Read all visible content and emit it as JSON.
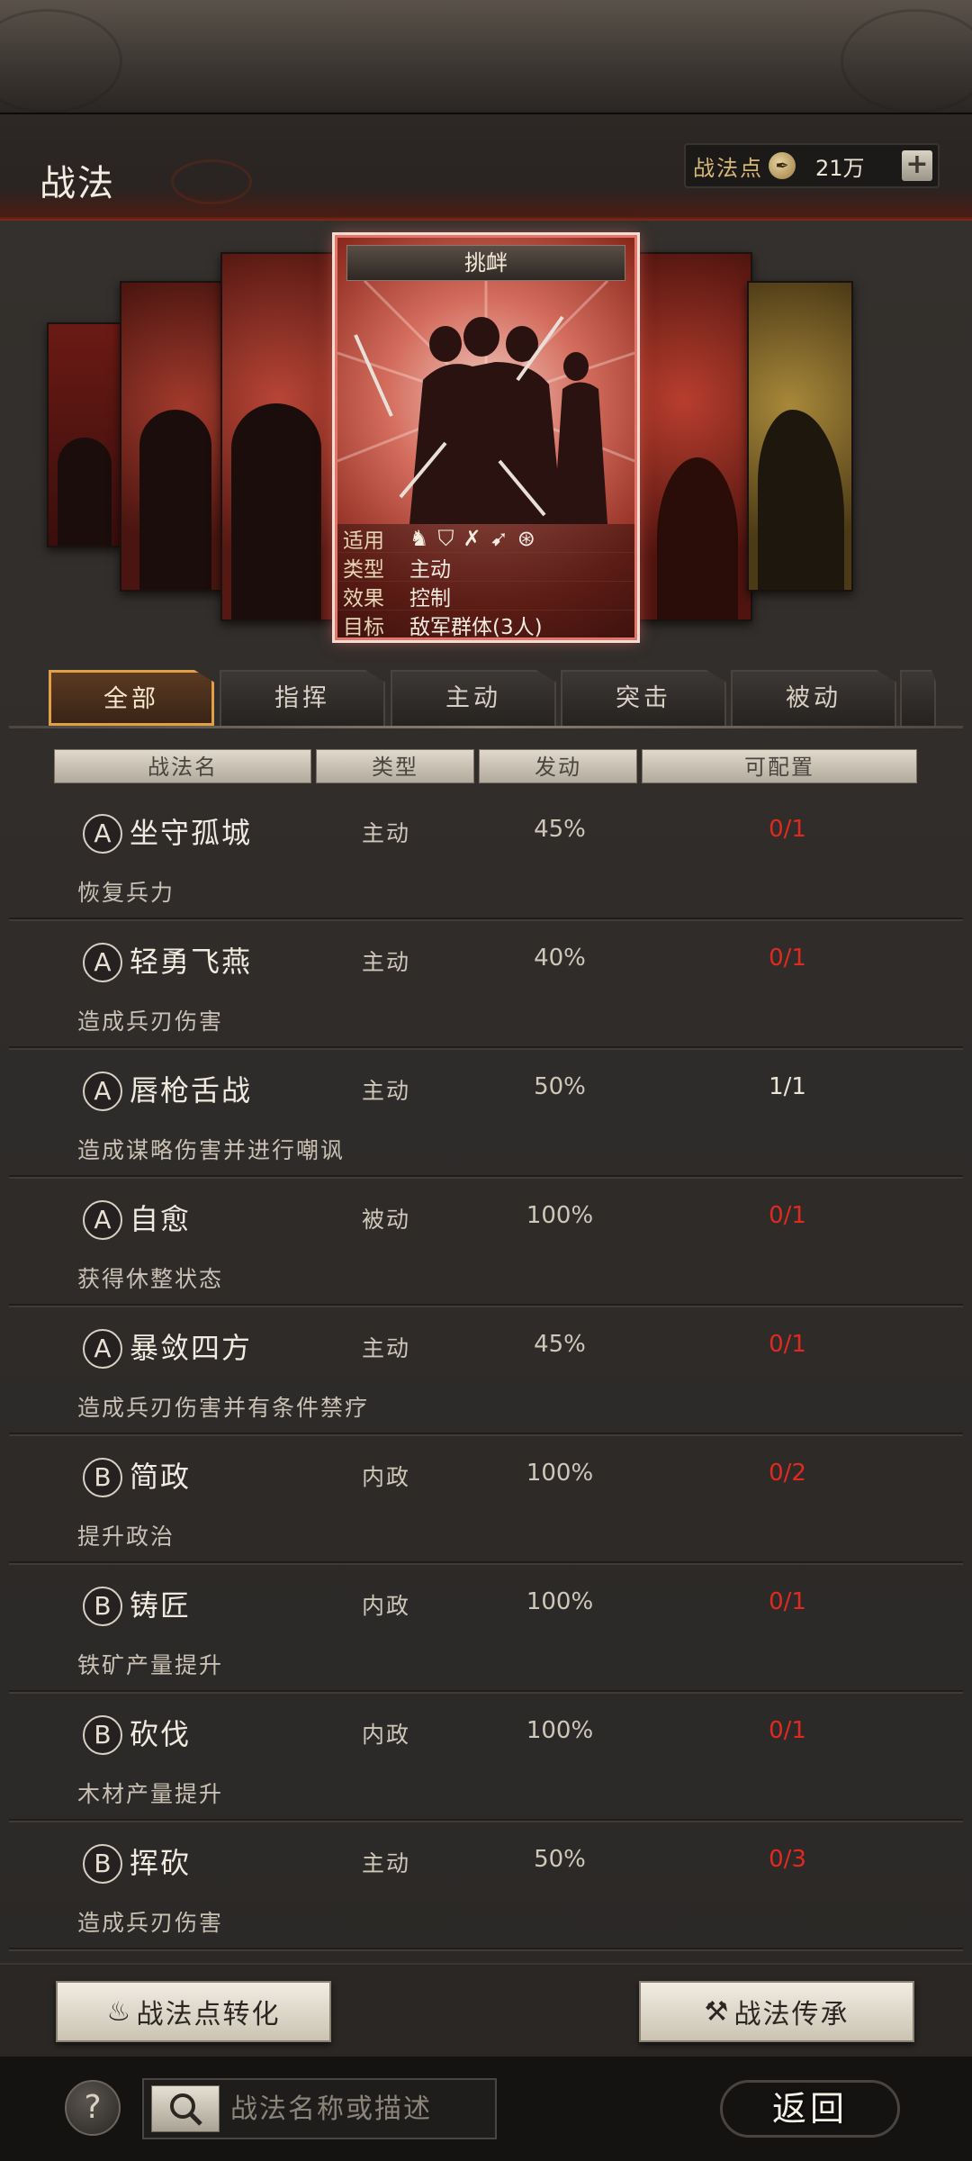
{
  "header": {
    "title": "战法",
    "points_label": "战法点",
    "points_value": "21万",
    "points_add": "+"
  },
  "featured_card": {
    "title": "挑衅",
    "rows": [
      {
        "key": "适用",
        "value": ""
      },
      {
        "key": "类型",
        "value": "主动"
      },
      {
        "key": "效果",
        "value": "控制"
      },
      {
        "key": "目标",
        "value": "敌军群体(3人)"
      }
    ],
    "terrain_icons": [
      "cavalry-icon",
      "shield-icon",
      "bow-icon",
      "spear-icon",
      "wheel-icon"
    ]
  },
  "tabs": [
    "全部",
    "指挥",
    "主动",
    "突击",
    "被动"
  ],
  "columns": [
    "战法名",
    "类型",
    "发动",
    "可配置"
  ],
  "skills": [
    {
      "grade": "A",
      "name": "坐守孤城",
      "type": "主动",
      "rate": "45%",
      "config": "0/1",
      "desc": "恢复兵力"
    },
    {
      "grade": "A",
      "name": "轻勇飞燕",
      "type": "主动",
      "rate": "40%",
      "config": "0/1",
      "desc": "造成兵刃伤害"
    },
    {
      "grade": "A",
      "name": "唇枪舌战",
      "type": "主动",
      "rate": "50%",
      "config": "1/1",
      "desc": "造成谋略伤害并进行嘲讽"
    },
    {
      "grade": "A",
      "name": "自愈",
      "type": "被动",
      "rate": "100%",
      "config": "0/1",
      "desc": "获得休整状态"
    },
    {
      "grade": "A",
      "name": "暴敛四方",
      "type": "主动",
      "rate": "45%",
      "config": "0/1",
      "desc": "造成兵刃伤害并有条件禁疗"
    },
    {
      "grade": "B",
      "name": "简政",
      "type": "内政",
      "rate": "100%",
      "config": "0/2",
      "desc": "提升政治"
    },
    {
      "grade": "B",
      "name": "铸匠",
      "type": "内政",
      "rate": "100%",
      "config": "0/1",
      "desc": "铁矿产量提升"
    },
    {
      "grade": "B",
      "name": "砍伐",
      "type": "内政",
      "rate": "100%",
      "config": "0/1",
      "desc": "木材产量提升"
    },
    {
      "grade": "B",
      "name": "挥砍",
      "type": "主动",
      "rate": "50%",
      "config": "0/3",
      "desc": "造成兵刃伤害"
    }
  ],
  "actions": {
    "convert_label": "战法点转化",
    "inherit_label": "战法传承"
  },
  "footer": {
    "help": "?",
    "search_placeholder": "战法名称或描述",
    "back_label": "返回"
  },
  "colors": {
    "unavailable": "#e02a20",
    "available": "#ece4d6",
    "tab_active_border": "#e2a046"
  }
}
